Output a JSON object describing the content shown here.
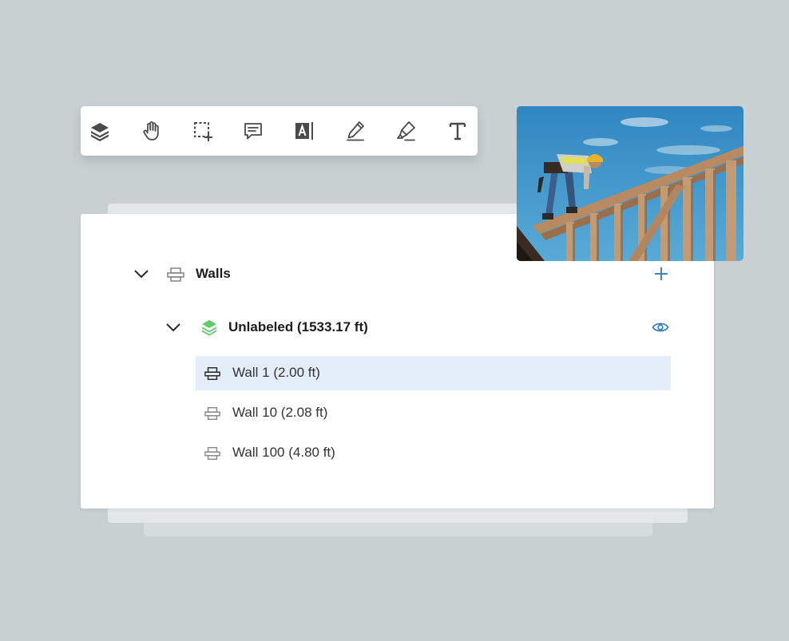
{
  "toolbar": {
    "tools": [
      {
        "icon": "layers-icon"
      },
      {
        "icon": "hand-pan-icon"
      },
      {
        "icon": "add-area-select-icon"
      },
      {
        "icon": "comment-icon"
      },
      {
        "icon": "text-highlight-icon"
      },
      {
        "icon": "pen-icon"
      },
      {
        "icon": "highlighter-icon"
      },
      {
        "icon": "text-icon"
      }
    ]
  },
  "tree": {
    "group": {
      "label": "Walls",
      "icon": "wall-icon",
      "action_icon": "plus-icon"
    },
    "subgroup": {
      "label": "Unlabeled (1533.17 ft)",
      "icon": "layers-green-icon",
      "action_icon": "eye-icon"
    },
    "items": [
      {
        "label": "Wall 1 (2.00 ft)",
        "selected": true
      },
      {
        "label": "Wall 10 (2.08 ft)",
        "selected": false
      },
      {
        "label": "Wall 100 (4.80 ft)",
        "selected": false
      }
    ]
  },
  "colors": {
    "background": "#c8d0d2",
    "accent_blue": "#3b82c4",
    "layer_green": "#5cc96a",
    "selected_row": "#e4eef8"
  }
}
